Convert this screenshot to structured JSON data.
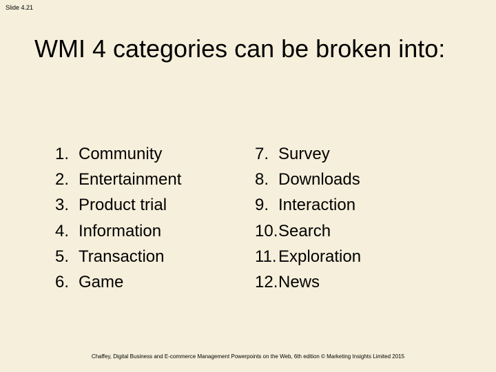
{
  "slide_number": "Slide 4.21",
  "title": "WMI 4 categories can be broken into:",
  "left_list": [
    {
      "n": "1.",
      "t": "Community"
    },
    {
      "n": "2.",
      "t": "Entertainment"
    },
    {
      "n": "3.",
      "t": "Product trial"
    },
    {
      "n": "4.",
      "t": "Information"
    },
    {
      "n": "5.",
      "t": "Transaction"
    },
    {
      "n": "6.",
      "t": "Game"
    }
  ],
  "right_list": [
    {
      "n": "7.",
      "t": "Survey"
    },
    {
      "n": "8.",
      "t": "Downloads"
    },
    {
      "n": "9.",
      "t": "Interaction"
    },
    {
      "n": "10.",
      "t": "Search"
    },
    {
      "n": "11.",
      "t": "Exploration"
    },
    {
      "n": "12.",
      "t": "News"
    }
  ],
  "footer": "Chaffey, Digital Business and E-commerce Management Powerpoints on the Web, 6th edition © Marketing Insights Limited 2015"
}
